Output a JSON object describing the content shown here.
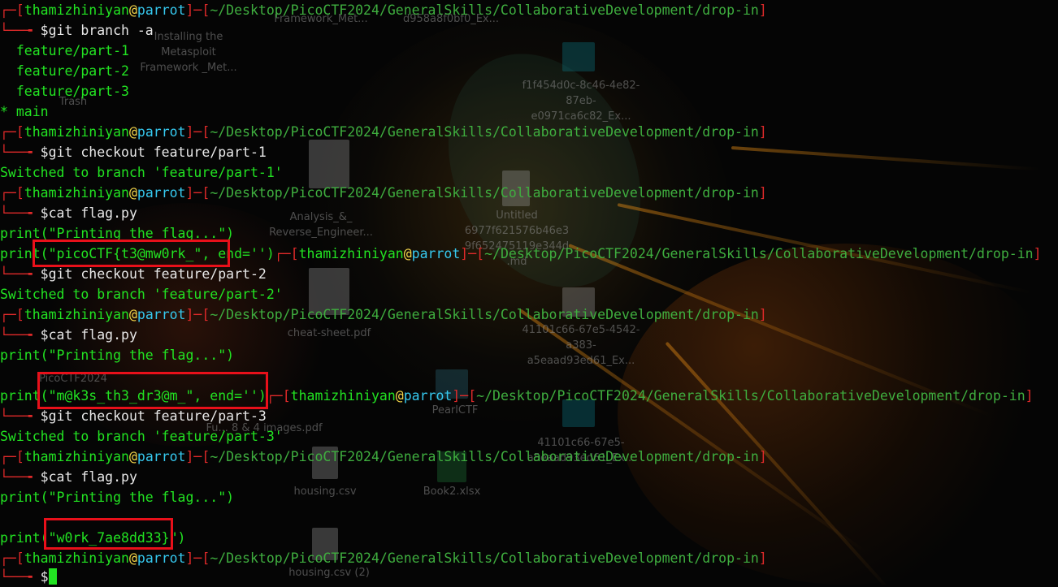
{
  "prompt": {
    "user": "thamizhiniyan",
    "at": "@",
    "host": "parrot",
    "path": "~/Desktop/PicoCTF2024/GeneralSkills/CollaborativeDevelopment/drop-in"
  },
  "lines": {
    "cmd_branch": "$git branch -a",
    "branch_1": "  feature/part-1",
    "branch_2": "  feature/part-2",
    "branch_3": "  feature/part-3",
    "branch_main": "* main",
    "cmd_checkout_1": "$git checkout feature/part-1",
    "switched_1": "Switched to branch 'feature/part-1'",
    "cmd_cat_1": "$cat flag.py",
    "printing_1": "print(\"Printing the flag...\")",
    "flag_1": "print(\"picoCTF{t3@mw0rk_\", end='')",
    "cmd_checkout_2": "$git checkout feature/part-2",
    "switched_2": "Switched to branch 'feature/part-2'",
    "cmd_cat_2": "$cat flag.py",
    "printing_2": "print(\"Printing the flag...\")",
    "flag_2": "print(\"m@k3s_th3_dr3@m_\", end='')",
    "cmd_checkout_3": "$git checkout feature/part-3",
    "switched_3": "Switched to branch 'feature/part-3'",
    "cmd_cat_3": "$cat flag.py",
    "printing_3": "print(\"Printing the flag...\")",
    "flag_3": "print(\"w0rk_7ae8dd33}\")",
    "final_prompt": "$"
  },
  "desktop_icons": {
    "installing": "Installing the Metasploit Framework _Met...",
    "trash": "Trash",
    "top_file_1": "Framework_Met...",
    "top_file_2": "d958a8f0bf0_Ex...",
    "hash_1": "f1f454d0c-8c46-4e82-87eb-e0971ca6c82_Ex...",
    "untitled": "Untitled 6977f621576b46e3 9f652475119e344d .md",
    "analysis": "Analysis_&_ Reverse_Engineer...",
    "cheat": "cheat-sheet.pdf",
    "hash_2": "41101c66-67e5-4542-a383-a5eaad93ed61_Ex...",
    "picoctf": "PicoCTF2024",
    "pearl": "PearlCTF",
    "images": "Fu... 8 & 4 images.pdf",
    "hash_3": "41101c66-67e5-a5eaad93ed61_Ex...",
    "housing": "housing.csv",
    "book2": "Book2.xlsx",
    "housing2": "housing.csv (2)"
  },
  "colors": {
    "prompt_bracket": "#e02a2a",
    "user": "#22e322",
    "host": "#36c9ef",
    "dollar": "#f3d54a",
    "output": "#22e322",
    "highlight_box": "#e8101a"
  }
}
